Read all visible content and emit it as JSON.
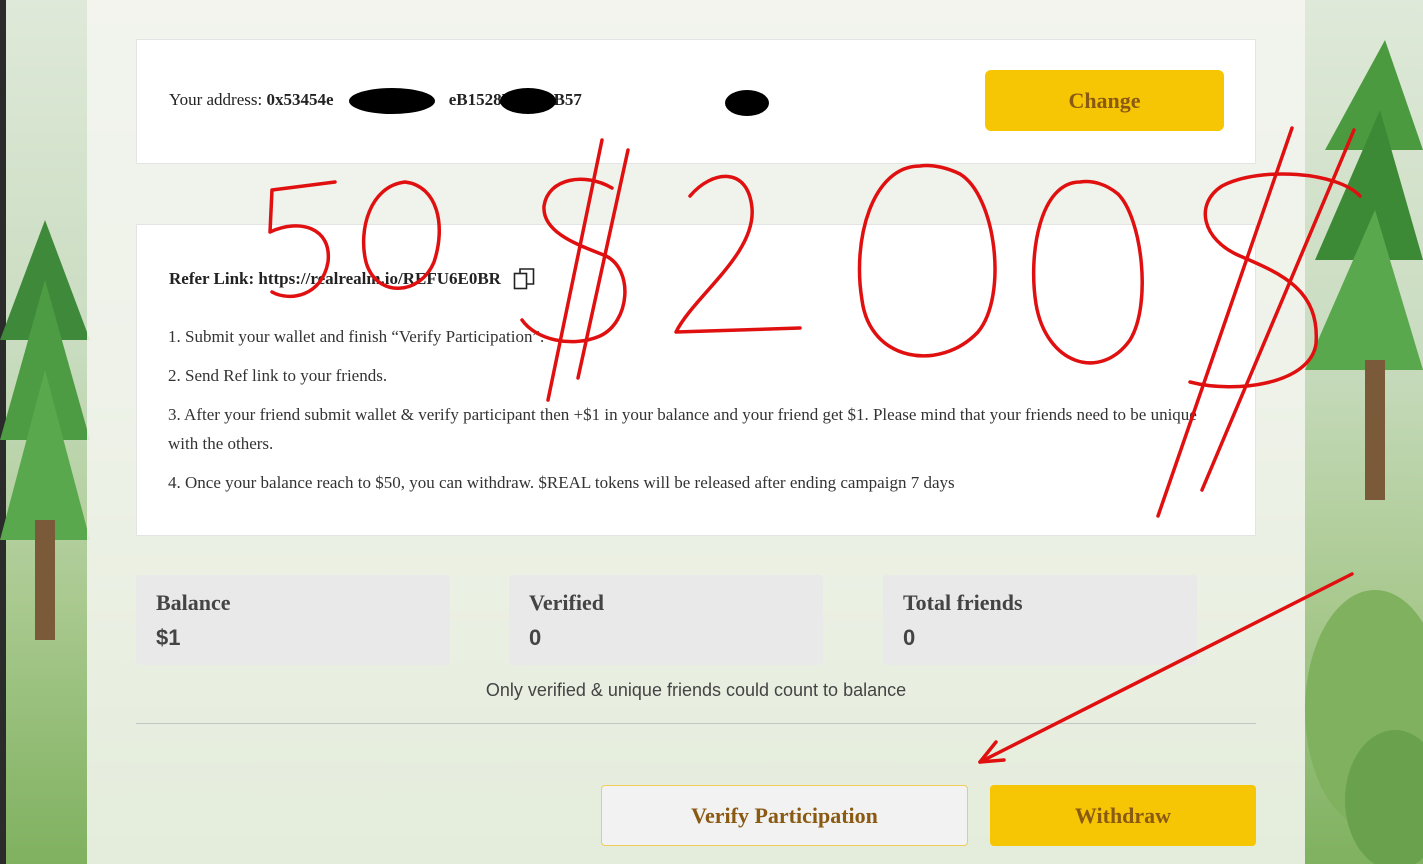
{
  "address": {
    "label": "Your address:",
    "value": "0x53454e        b545C8      eB1528BBD32B57",
    "change_label": "Change"
  },
  "refer": {
    "label": "Refer Link:",
    "link": "https://realrealm.io/REFU6E0BR",
    "steps": [
      "1. Submit your wallet and finish “Verify Participation”.",
      "2. Send Ref link to your friends.",
      "3. After your friend submit wallet & verify participant then +$1 in your balance and your friend get $1. Please mind that your friends need to be unique with the others.",
      "4. Once your balance reach to $50, you can withdraw. $REAL tokens will be released after ending campaign 7 days"
    ]
  },
  "stats": [
    {
      "label": "Balance",
      "value": "$1"
    },
    {
      "label": "Verified",
      "value": "0"
    },
    {
      "label": "Total friends",
      "value": "0"
    }
  ],
  "note": "Only verified & unique friends could count to balance",
  "buttons": {
    "verify_label": "Verify Participation",
    "withdraw_label": "Withdraw"
  },
  "annotation": {
    "text": "50$200$",
    "color": "#e01010"
  },
  "colors": {
    "accent": "#f6c604",
    "button_text": "#8a5a12"
  }
}
